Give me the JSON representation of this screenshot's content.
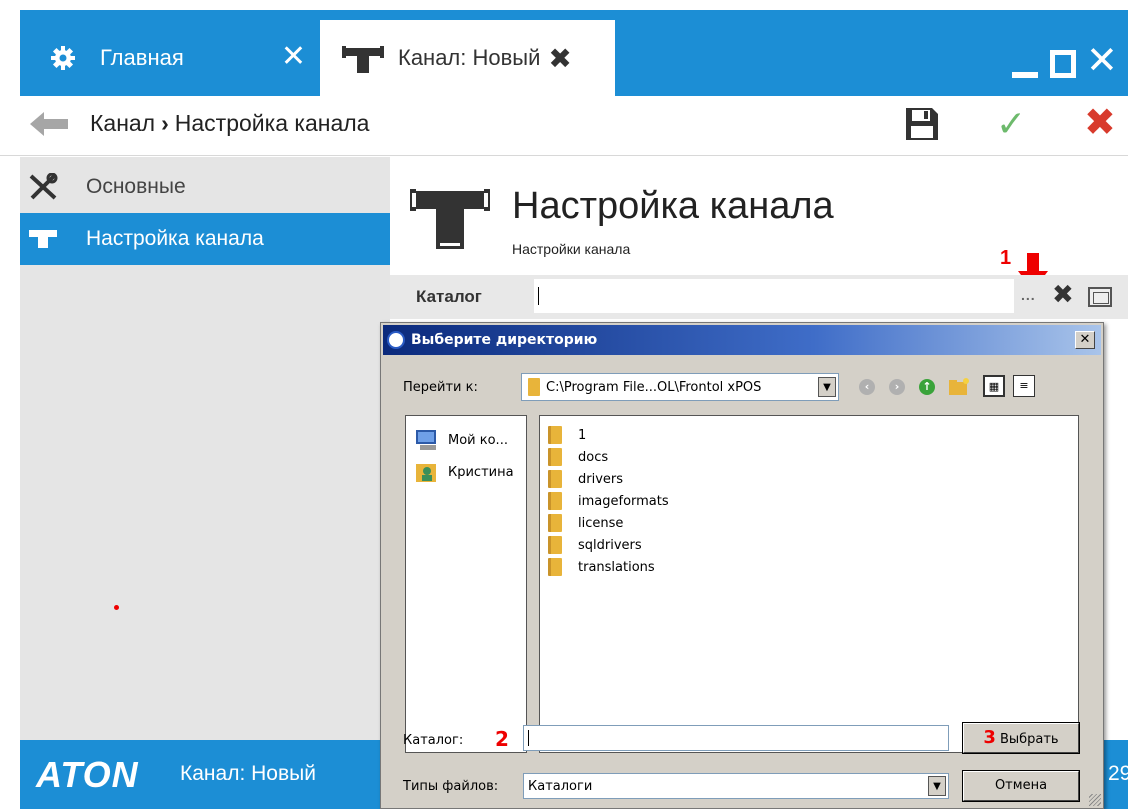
{
  "tabs": [
    {
      "label": "Главная",
      "icon": "gear-icon",
      "active": false
    },
    {
      "label": "Канал: Новый",
      "icon": "pipe-tee-icon",
      "active": true
    }
  ],
  "breadcrumb": {
    "root": "Канал",
    "separator": "›",
    "current": "Настройка канала"
  },
  "toolbar": {
    "save": "save-icon",
    "ok": "✓",
    "cancel": "✖"
  },
  "sidebar": {
    "items": [
      {
        "label": "Основные",
        "icon": "tools-icon",
        "selected": false
      },
      {
        "label": "Настройка канала",
        "icon": "pipe-tee-icon",
        "selected": true
      }
    ]
  },
  "page": {
    "title": "Настройка канала",
    "subtitle": "Настройки канала"
  },
  "field": {
    "label": "Каталог",
    "value": "",
    "dots": "...",
    "clear": "✖"
  },
  "annotations": {
    "a1": "1",
    "a2": "2",
    "a3": "3"
  },
  "footer": {
    "logo": "ATON",
    "doc": "Канал: Новый",
    "num": "29"
  },
  "dialog": {
    "title": "Выберите директорию",
    "goto_label": "Перейти к:",
    "goto_path": "C:\\Program File...OL\\Frontol xPOS",
    "places": [
      {
        "label": "Мой ко...",
        "icon": "my-computer-icon"
      },
      {
        "label": "Кристина",
        "icon": "user-folder-icon"
      }
    ],
    "folders": [
      "1",
      "docs",
      "drivers",
      "imageformats",
      "license",
      "sqldrivers",
      "translations"
    ],
    "catalog_label": "Каталог:",
    "catalog_value": "",
    "choose": "Выбрать",
    "filetypes_label": "Типы файлов:",
    "filetypes_value": "Каталоги",
    "cancel": "Отмена",
    "close": "✕"
  },
  "colors": {
    "accent": "#1c8ed5",
    "ok": "#6dba6c",
    "danger": "#d83a2c",
    "annotation": "#e00000"
  }
}
